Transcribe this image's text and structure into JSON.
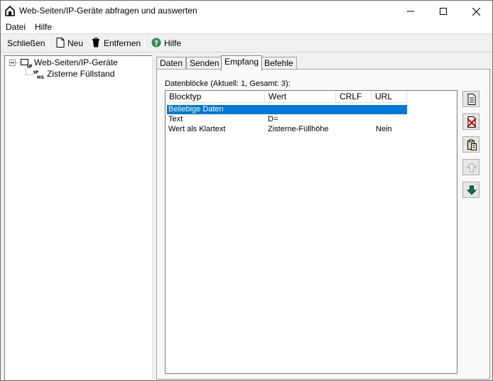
{
  "window": {
    "title": "Web-Seiten/IP-Geräte abfragen und auswerten"
  },
  "menu": [
    "Datei",
    "Hilfe"
  ],
  "toolbar": {
    "close_label": "Schließen",
    "new_label": "Neu",
    "remove_label": "Entfernen",
    "help_label": "Hilfe"
  },
  "tree": {
    "root": "Web-Seiten/IP-Geräte",
    "child": "Zisterne Füllstand"
  },
  "tabs": [
    "Daten",
    "Senden",
    "Empfang",
    "Befehle"
  ],
  "active_tab": "Empfang",
  "panel": {
    "datablocks_label": "Datenblöcke (Aktuell: 1, Gesamt: 3):",
    "columns": [
      "Blocktyp",
      "Wert",
      "CRLF",
      "URL"
    ],
    "rows": [
      {
        "blocktyp": "Beliebige Daten",
        "wert": "",
        "crlf": "",
        "url": ""
      },
      {
        "blocktyp": "Text",
        "wert": "D=",
        "crlf": "",
        "url": ""
      },
      {
        "blocktyp": "Wert als Klartext",
        "wert": "Zisterne-Füllhöhe",
        "crlf": "",
        "url": "Nein"
      }
    ]
  }
}
